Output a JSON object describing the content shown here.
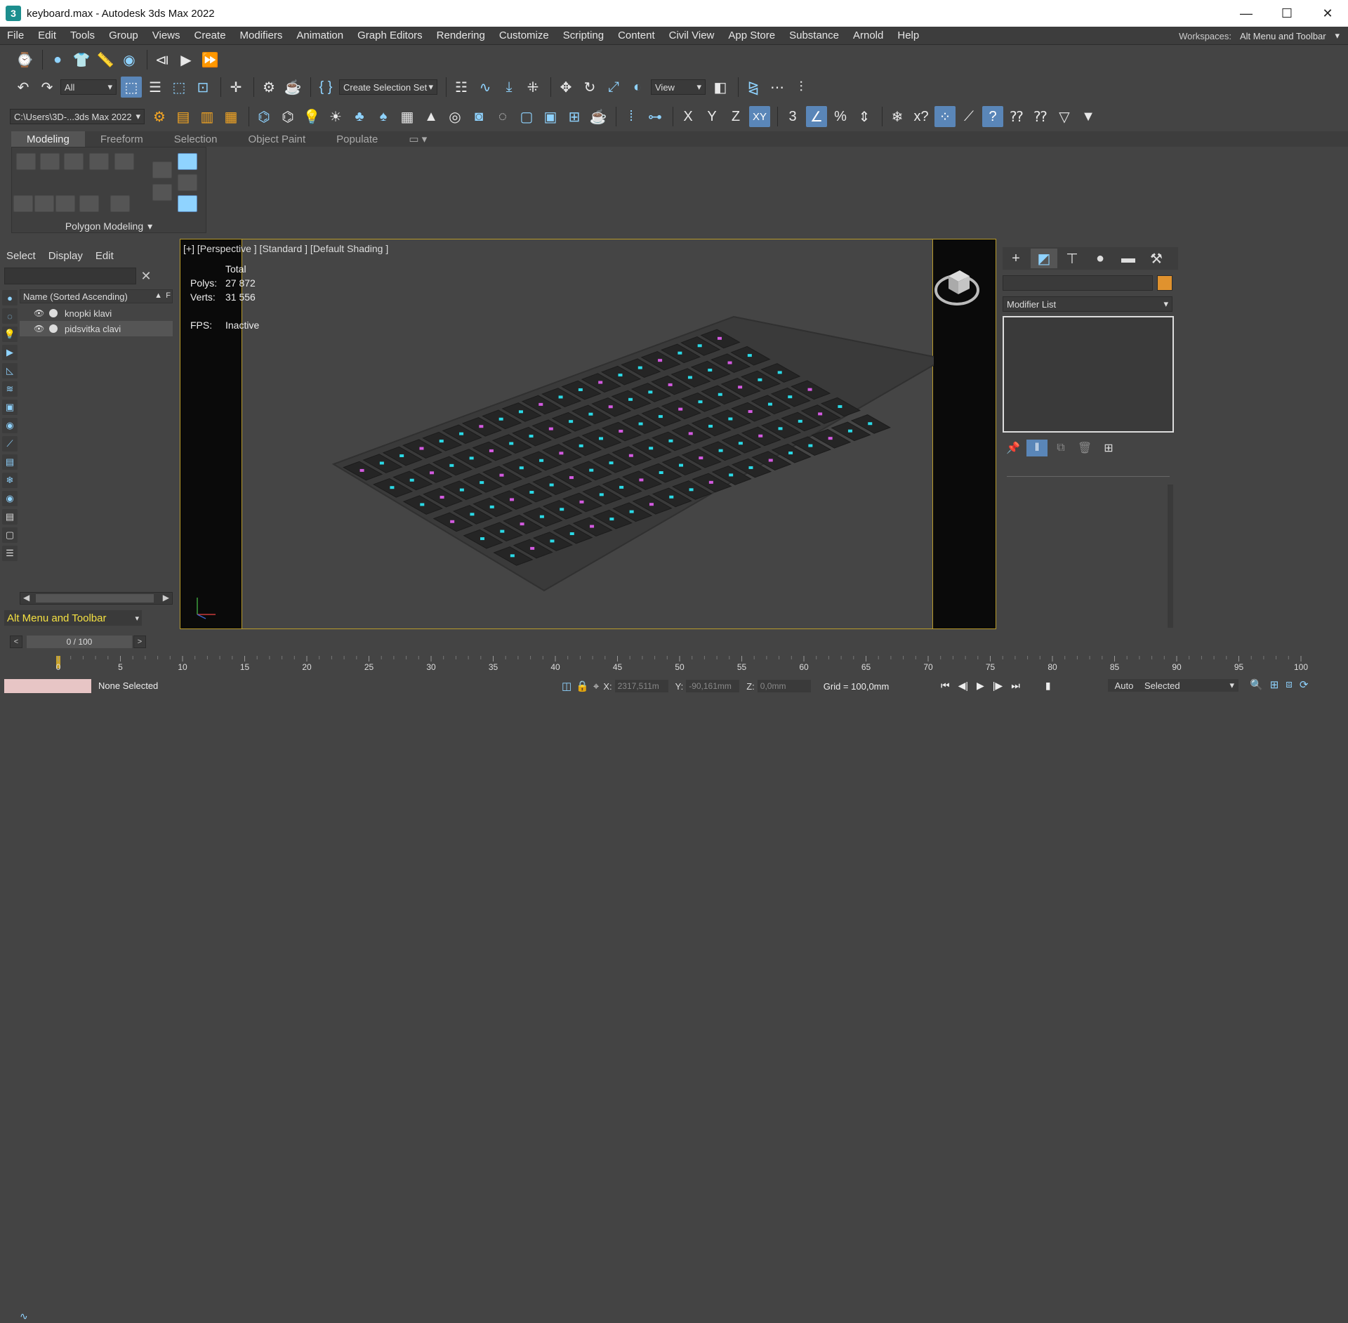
{
  "window": {
    "title": "keyboard.max - Autodesk 3ds Max 2022",
    "logo_text": "3",
    "minimize": "—",
    "maximize": "☐",
    "close": "✕"
  },
  "menu": [
    "File",
    "Edit",
    "Tools",
    "Group",
    "Views",
    "Create",
    "Modifiers",
    "Animation",
    "Graph Editors",
    "Rendering",
    "Customize",
    "Scripting",
    "Content",
    "Civil View",
    "App Store",
    "Substance",
    "Arnold",
    "Help"
  ],
  "workspace": {
    "label": "Workspaces:",
    "value": "Alt Menu and Toolbar"
  },
  "toolbar": {
    "filter": "All",
    "selection_set": "Create Selection Set",
    "ref_coord": "View",
    "project_path": "C:\\Users\\3D-...3ds Max 2022",
    "axis_x": "X",
    "axis_y": "Y",
    "axis_z": "Z",
    "axis_xy": "XY"
  },
  "ribbon": {
    "tabs": [
      "Modeling",
      "Freeform",
      "Selection",
      "Object Paint",
      "Populate"
    ],
    "active_tab": "Modeling",
    "panel_label": "Polygon Modeling"
  },
  "scene_explorer": {
    "tabs": [
      "Select",
      "Display",
      "Edit"
    ],
    "column_header": "Name (Sorted Ascending)",
    "sort_indicator": "▲",
    "column_extra": "F",
    "rows": [
      {
        "name": "knopki klavi",
        "selected": false
      },
      {
        "name": "pidsvitka clavi",
        "selected": true
      }
    ],
    "workspace_bottom": "Alt Menu and Toolbar"
  },
  "viewport": {
    "label": "[+] [Perspective ] [Standard ] [Default Shading ]",
    "stats_header": "Total",
    "polys_label": "Polys:",
    "polys_value": "27 872",
    "verts_label": "Verts:",
    "verts_value": "31 556",
    "fps_label": "FPS:",
    "fps_value": "Inactive"
  },
  "command_panel": {
    "modifier_list": "Modifier List",
    "object_color": "#e0922e"
  },
  "timeline": {
    "frame": "0 / 100",
    "ticks": [
      "0",
      "5",
      "10",
      "15",
      "20",
      "25",
      "30",
      "35",
      "40",
      "45",
      "50",
      "55",
      "60",
      "65",
      "70",
      "75",
      "80",
      "85",
      "90",
      "95",
      "100"
    ]
  },
  "status": {
    "selection": "None Selected",
    "x_label": "X:",
    "x_value": "2317,511m",
    "y_label": "Y:",
    "y_value": "-90,161mm",
    "z_label": "Z:",
    "z_value": "0,0mm",
    "grid": "Grid = 100,0mm",
    "auto_key": "Auto",
    "key_filter": "Selected"
  },
  "colors": {
    "accent_blue": "#8fd3ff",
    "highlight": "#5a86b8",
    "viewport_border": "#b89a2a",
    "key_cyan": "#2bd9e6",
    "key_magenta": "#d35ae0"
  }
}
